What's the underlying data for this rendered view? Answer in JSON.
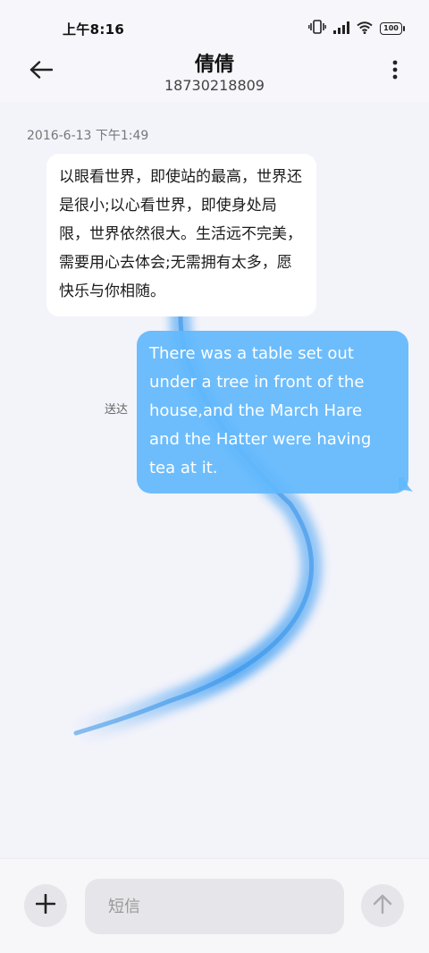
{
  "status_bar": {
    "time": "上午8:16",
    "battery": "100",
    "icons": [
      "vibrate-icon",
      "signal-icon",
      "wifi-icon",
      "battery-icon"
    ]
  },
  "header": {
    "contact_name": "倩倩",
    "phone_number": "18730218809",
    "back_icon": "back-arrow-icon",
    "more_icon": "more-vertical-icon"
  },
  "conversation": {
    "timestamp": "2016-6-13 下午1:49",
    "incoming_message": "以眼看世界，即使站的最高，世界还是很小;以心看世界，即使身处局限，世界依然很大。生活远不完美，需要用心去体会;无需拥有太多，愿快乐与你相随。",
    "outgoing_message": "There was a table set out under a tree in front of the house,and the March Hare and the Hatter were having tea at it.",
    "delivery_status": "送达"
  },
  "composer": {
    "placeholder": "短信",
    "add_icon": "plus-icon",
    "send_icon": "send-arrow-up-icon"
  },
  "colors": {
    "outgoing_bubble": "#62b8fc",
    "incoming_bubble": "#ffffff",
    "background": "#f3f3fa"
  }
}
